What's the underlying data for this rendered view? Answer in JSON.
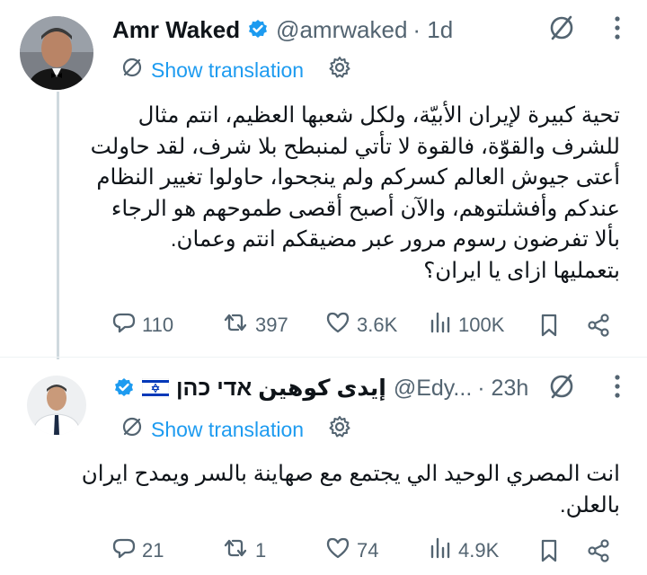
{
  "tweets": [
    {
      "author_name": "Amr Waked",
      "handle": "@amrwaked",
      "time": "· 1d",
      "show_translation": "Show translation",
      "lines": [
        "تحية كبيرة لإيران الأبيّة، ولكل شعبها العظيم، انتم مثال",
        "للشرف والقوّة، فالقوة لا تأتي لمنبطح بلا شرف، لقد حاولت",
        "أعتى جيوش العالم كسركم ولم ينجحوا، حاولوا تغيير النظام",
        "عندكم وأفشلتوهم، والآن أصبح أقصى طموحهم هو الرجاء",
        "بألا تفرضون رسوم مرور عبر مضيقكم انتم وعمان.",
        "بتعمليها ازاى يا ايران؟"
      ],
      "stats": {
        "replies": "110",
        "reposts": "397",
        "likes": "3.6K",
        "views": "100K"
      }
    },
    {
      "author_name": "إيدى كوهين אדי כהן",
      "handle": "@Edy...",
      "time": "· 23h",
      "show_translation": "Show translation",
      "lines": [
        "انت المصري الوحيد الي يجتمع مع صهاينة بالسر ويمدح ايران",
        "بالعلن."
      ],
      "stats": {
        "replies": "21",
        "reposts": "1",
        "likes": "74",
        "views": "4.9K"
      }
    }
  ],
  "colors": {
    "accent": "#1d9bf0",
    "muted": "#536471",
    "text": "#0f1419"
  },
  "icons": [
    "verified-badge-icon",
    "israel-flag-icon",
    "muted-icon",
    "more-icon",
    "globe-icon",
    "gear-icon",
    "reply-icon",
    "repost-icon",
    "like-icon",
    "views-icon",
    "bookmark-icon",
    "share-icon"
  ]
}
